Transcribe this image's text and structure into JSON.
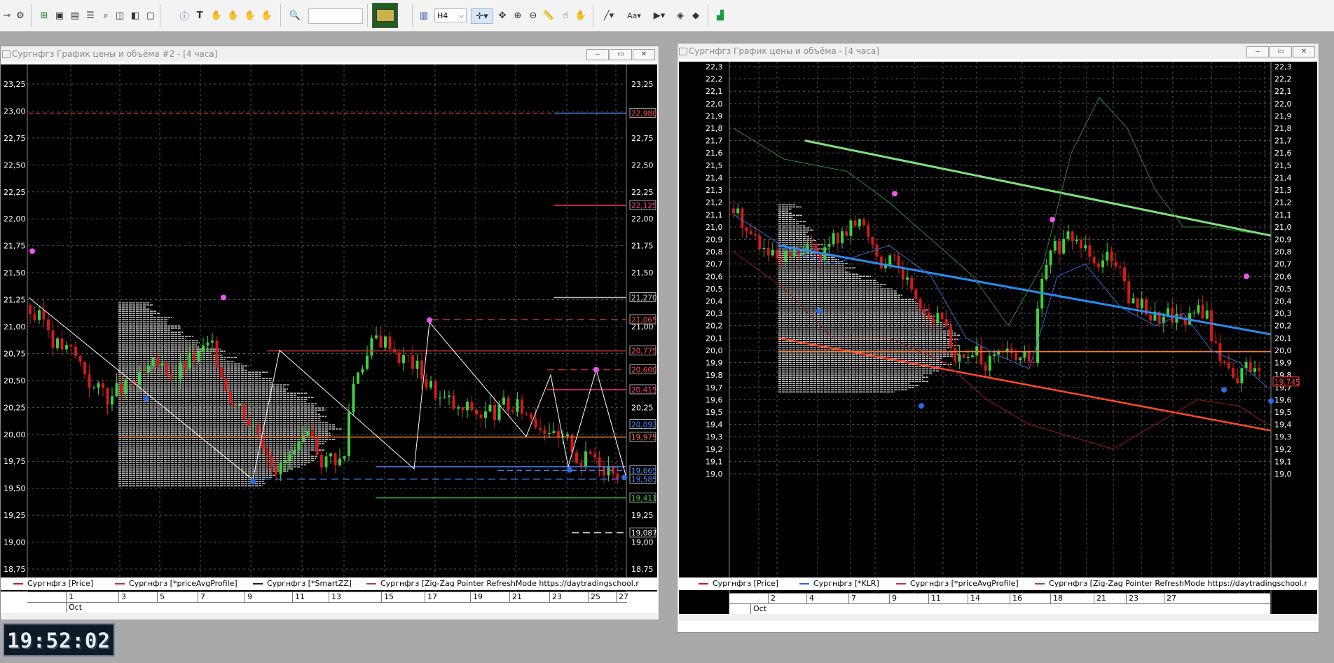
{
  "toolbar": {
    "timeframe": "H4",
    "search_placeholder": "",
    "icons": [
      "connect-icon",
      "instruments-icon",
      "add-chart-icon",
      "chart-window-icon",
      "chart-window-icon",
      "table-icon",
      "zoom-chart-icon",
      "chart-window-icon",
      "chart-window-icon",
      "chart-window-icon",
      "alert-icon",
      "text-tool-icon",
      "hand-icon",
      "hand-icon",
      "hand-icon",
      "hand-icon",
      "search-icon",
      "bars-icon",
      "crosshair-icon",
      "move-icon",
      "zoom-in-icon",
      "zoom-out-icon",
      "ruler-icon",
      "hand-icon",
      "pan-icon",
      "line-tool-icon",
      "font-icon",
      "pointer-icon",
      "eye-icon",
      "layers-icon",
      "indicator-icon"
    ]
  },
  "clock": {
    "time": "19:52:02"
  },
  "window_left": {
    "title": "Сургнфгз График цены и объёма #2 - [4 часа]",
    "minimize": "‒",
    "maximize": "▭",
    "close": "✕",
    "y_labels_left": [
      "23,25",
      "23,00",
      "22,75",
      "22,50",
      "22,25",
      "22,00",
      "21,75",
      "21,50",
      "21,25",
      "21,00",
      "20,75",
      "20,50",
      "20,25",
      "20,00",
      "19,75",
      "19,50",
      "19,25",
      "19,00",
      "18,75"
    ],
    "y_labels_right": [
      "23,25",
      "22,75",
      "22,50",
      "22,25",
      "22,00",
      "21,75",
      "21,50",
      "21,00",
      "20,25",
      "20,00",
      "19,25",
      "19,00",
      "18,75"
    ],
    "price_tags": [
      {
        "text": "22,980",
        "color": "#ff5050"
      },
      {
        "text": "22,125",
        "color": "#ff3a8c"
      },
      {
        "text": "21,270",
        "color": "#c0c0c0"
      },
      {
        "text": "21,065",
        "color": "#ff5050"
      },
      {
        "text": "20,775",
        "color": "#ff5050"
      },
      {
        "text": "20,600",
        "color": "#ff5050"
      },
      {
        "text": "20,415",
        "color": "#ff3a8c"
      },
      {
        "text": "20,093",
        "color": "#4a8cff"
      },
      {
        "text": "19,975",
        "color": "#ff7a3a"
      },
      {
        "text": "19,665",
        "color": "#4a8cff"
      },
      {
        "text": "19,585",
        "color": "#4a8cff"
      },
      {
        "text": "19,411",
        "color": "#40d040"
      },
      {
        "text": "19,087",
        "color": "#ffffff"
      }
    ],
    "x_labels": [
      "1",
      "3",
      "5",
      "7",
      "9",
      "11",
      "13",
      "15",
      "17",
      "19",
      "21",
      "23",
      "25",
      "27"
    ],
    "month_label": "Oct",
    "legend": [
      {
        "label": "Сургнфгз [Price]",
        "color": "#c81818"
      },
      {
        "label": "Сургнфгз [*priceAvgProfile]",
        "color": "#c83030"
      },
      {
        "label": "Сургнфгз [*SmartZZ]",
        "color": "#202020"
      },
      {
        "label": "Сургнфгз [Zig-Zag Pointer RefreshMode https://daytradingschool.r",
        "color": "#b04040"
      }
    ]
  },
  "window_right": {
    "title": "Сургнфгз График цены и объёма - [4 часа]",
    "minimize": "‒",
    "maximize": "▭",
    "close": "✕",
    "y_labels": [
      "22,3",
      "22,2",
      "22,1",
      "22,0",
      "21,9",
      "21,8",
      "21,7",
      "21,6",
      "21,5",
      "21,4",
      "21,3",
      "21,2",
      "21,1",
      "21,0",
      "20,9",
      "20,8",
      "20,7",
      "20,6",
      "20,5",
      "20,4",
      "20,3",
      "20,2",
      "20,1",
      "20,0",
      "19,9",
      "19,8",
      "19,7",
      "19,6",
      "19,5",
      "19,4",
      "19,3",
      "19,2",
      "19,1",
      "19,0"
    ],
    "price_tag": {
      "text": "19,745",
      "color": "#ff4040"
    },
    "x_labels": [
      "2",
      "4",
      "7",
      "9",
      "11",
      "14",
      "16",
      "18",
      "21",
      "23",
      "27"
    ],
    "month_label": "Oct",
    "legend": [
      {
        "label": "Сургнфгз [Price]",
        "color": "#c81818"
      },
      {
        "label": "Сургнфгз [*KLR]",
        "color": "#2a6bd8"
      },
      {
        "label": "Сургнфгз [*priceAvgProfile]",
        "color": "#c83030"
      },
      {
        "label": "Сургнфгз [Zig-Zag Pointer RefreshMode https://daytradingschool.r",
        "color": "#c020a0"
      }
    ]
  }
}
